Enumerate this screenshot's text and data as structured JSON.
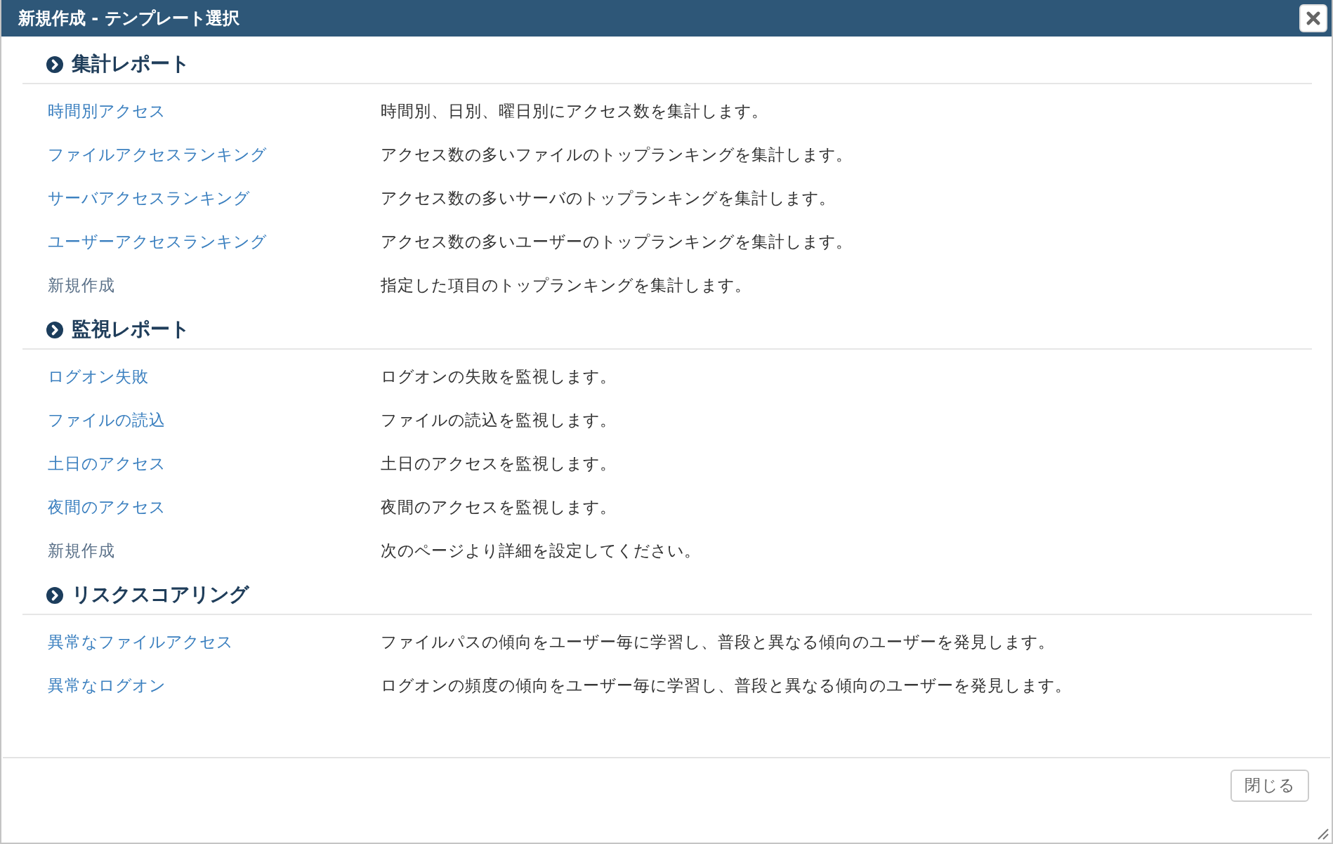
{
  "window": {
    "title": "新規作成 - テンプレート選択"
  },
  "sections": [
    {
      "title": "集計レポート",
      "items": [
        {
          "name": "時間別アクセス",
          "description": "時間別、日別、曜日別にアクセス数を集計します。",
          "kind": "template"
        },
        {
          "name": "ファイルアクセスランキング",
          "description": "アクセス数の多いファイルのトップランキングを集計します。",
          "kind": "template"
        },
        {
          "name": "サーバアクセスランキング",
          "description": "アクセス数の多いサーバのトップランキングを集計します。",
          "kind": "template"
        },
        {
          "name": "ユーザーアクセスランキング",
          "description": "アクセス数の多いユーザーのトップランキングを集計します。",
          "kind": "template"
        },
        {
          "name": "新規作成",
          "description": "指定した項目のトップランキングを集計します。",
          "kind": "new"
        }
      ]
    },
    {
      "title": "監視レポート",
      "items": [
        {
          "name": "ログオン失敗",
          "description": "ログオンの失敗を監視します。",
          "kind": "template"
        },
        {
          "name": "ファイルの読込",
          "description": "ファイルの読込を監視します。",
          "kind": "template"
        },
        {
          "name": "土日のアクセス",
          "description": "土日のアクセスを監視します。",
          "kind": "template"
        },
        {
          "name": "夜間のアクセス",
          "description": "夜間のアクセスを監視します。",
          "kind": "template"
        },
        {
          "name": "新規作成",
          "description": "次のページより詳細を設定してください。",
          "kind": "new"
        }
      ]
    },
    {
      "title": "リスクスコアリング",
      "items": [
        {
          "name": "異常なファイルアクセス",
          "description": "ファイルパスの傾向をユーザー毎に学習し、普段と異なる傾向のユーザーを発見します。",
          "kind": "template"
        },
        {
          "name": "異常なログオン",
          "description": "ログオンの頻度の傾向をユーザー毎に学習し、普段と異なる傾向のユーザーを発見します。",
          "kind": "template"
        }
      ]
    }
  ],
  "footer": {
    "buttons": [
      "閉じる"
    ]
  }
}
